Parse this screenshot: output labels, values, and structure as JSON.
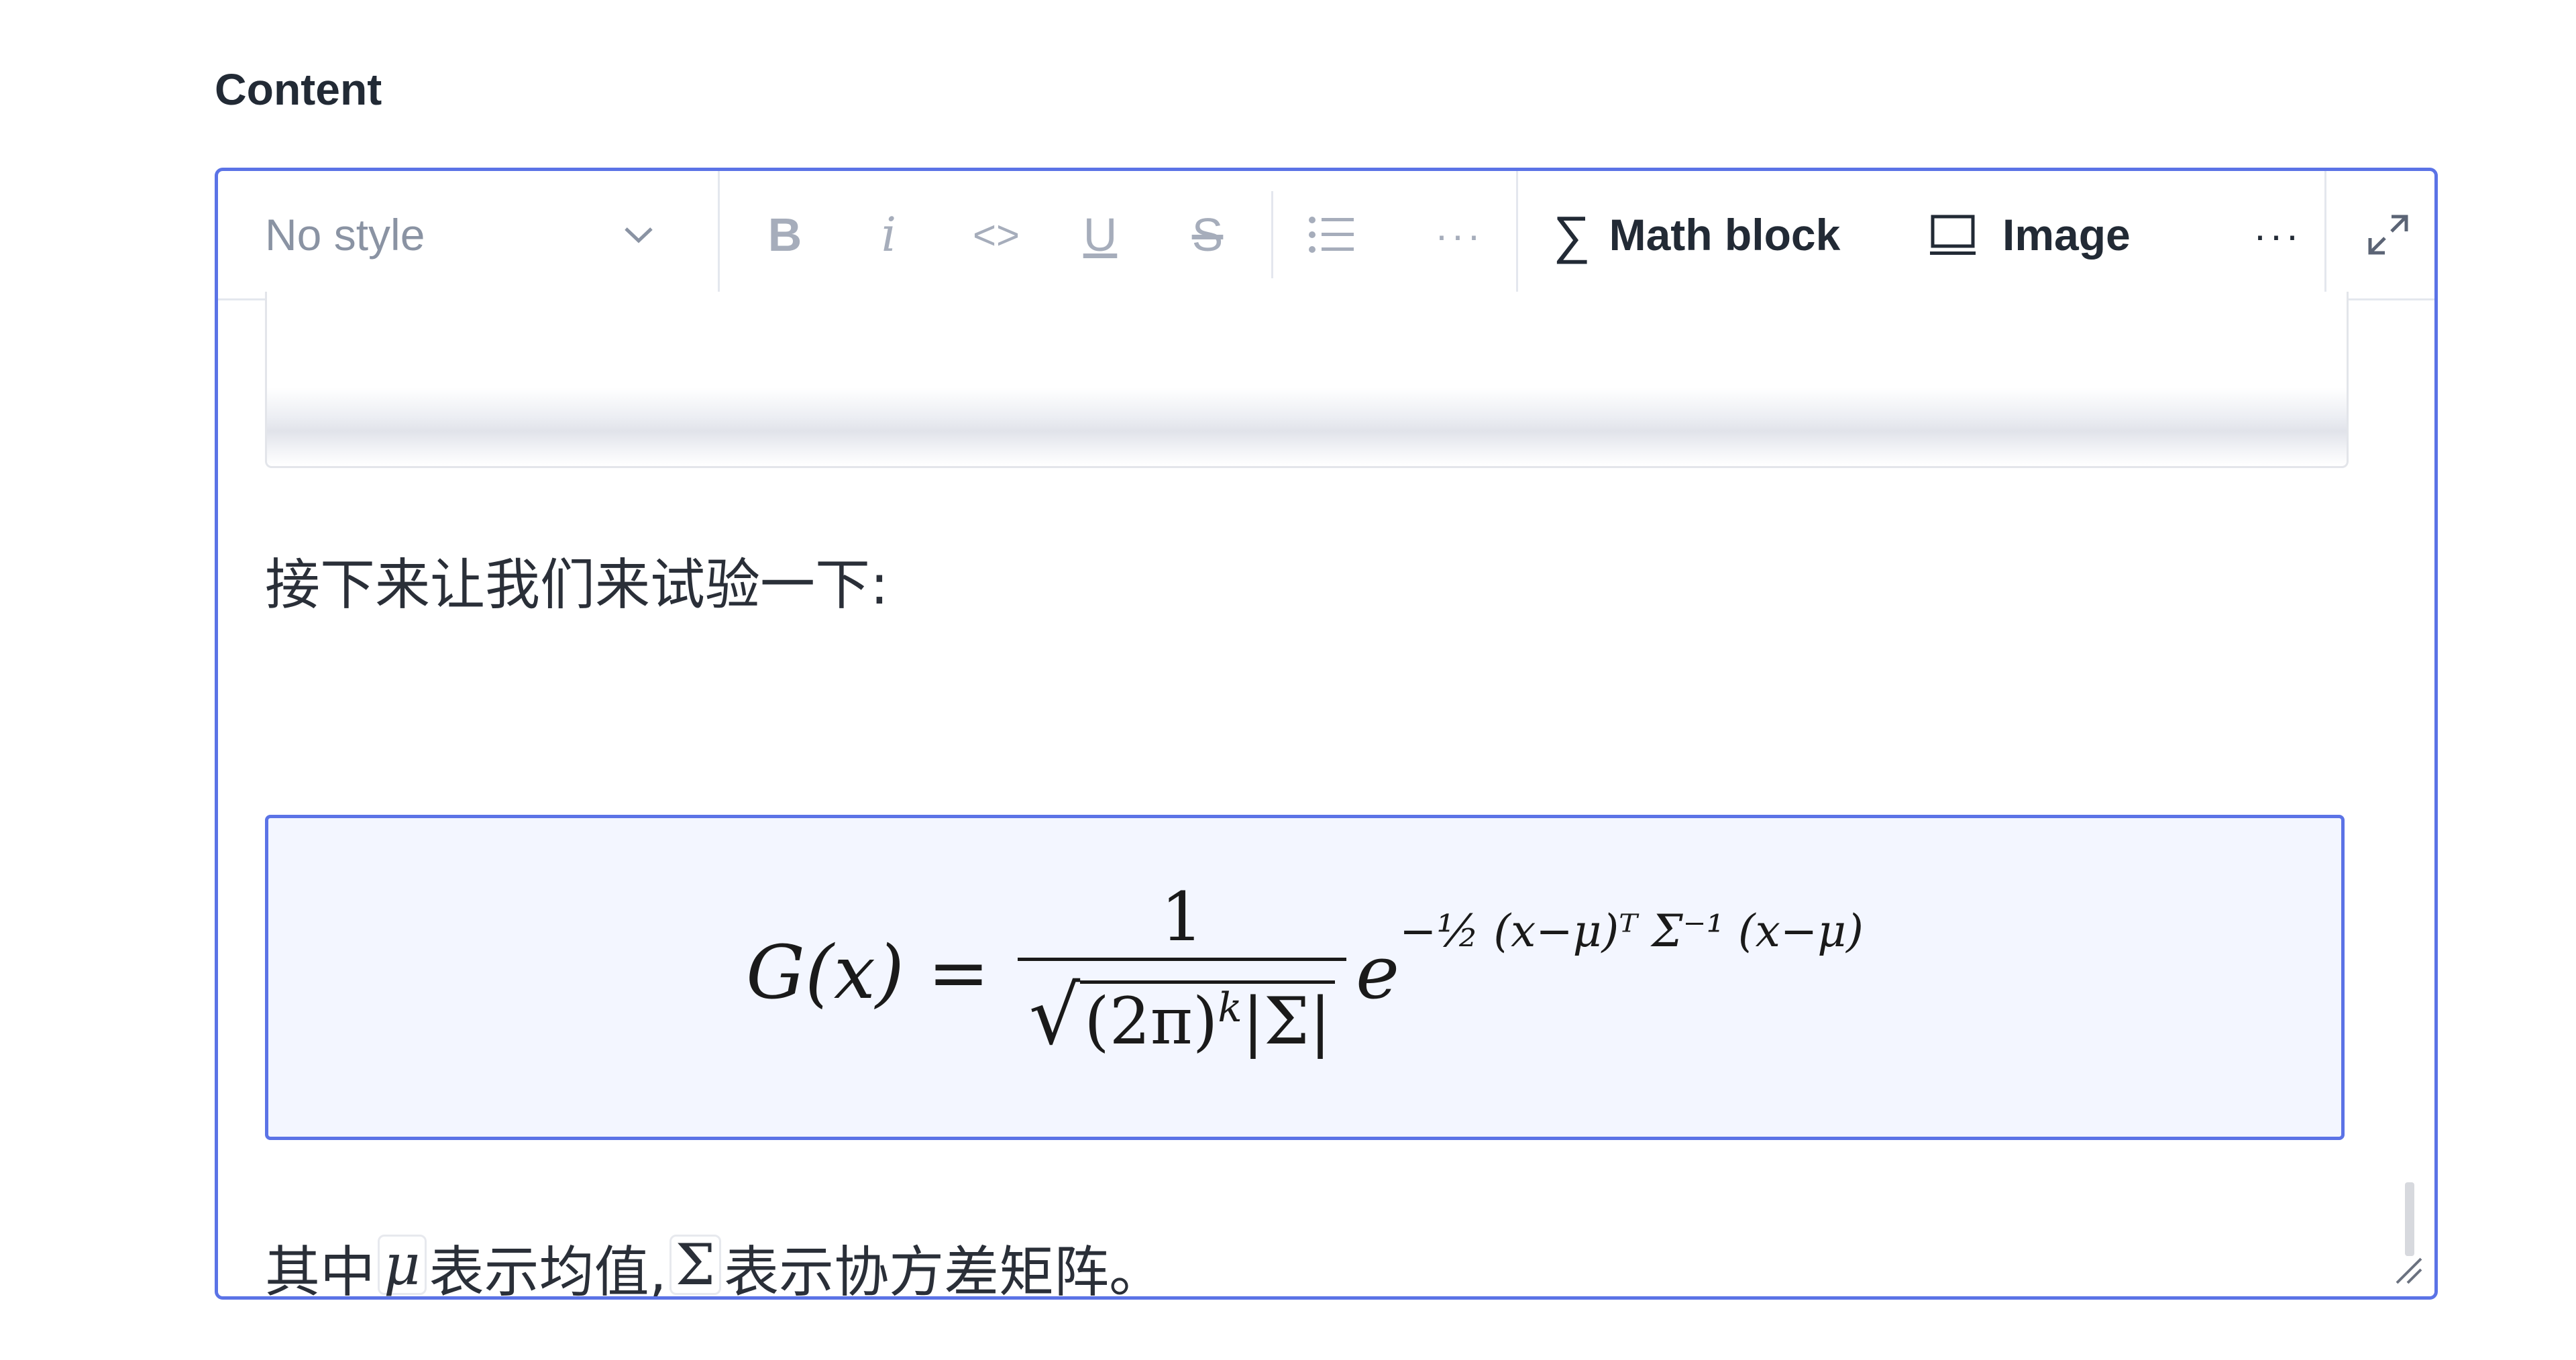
{
  "field": {
    "label": "Content"
  },
  "toolbar": {
    "style_select": "No style",
    "bold": "B",
    "italic": "i",
    "code": "<>",
    "underline": "U",
    "strike": "S",
    "more1": "···",
    "math_block_label": "Math block",
    "image_label": "Image",
    "more2": "···"
  },
  "content": {
    "para1": "接下来让我们来试验一下:",
    "para2_part1": "其中",
    "inline_mu": "μ",
    "para2_part2": "表示均值,",
    "inline_sigma": "Σ",
    "para2_part3": "表示协方差矩阵。"
  },
  "math": {
    "lhs": "G(x) =",
    "numerator": "1",
    "denom_inner": "(2π)",
    "denom_exp": "k",
    "denom_abs": "|Σ|",
    "base": "e",
    "exponent": "−½ (x−μ)ᵀ Σ⁻¹ (x−μ)"
  },
  "colors": {
    "accent": "#5b73e6",
    "math_bg": "#f3f6ff"
  }
}
